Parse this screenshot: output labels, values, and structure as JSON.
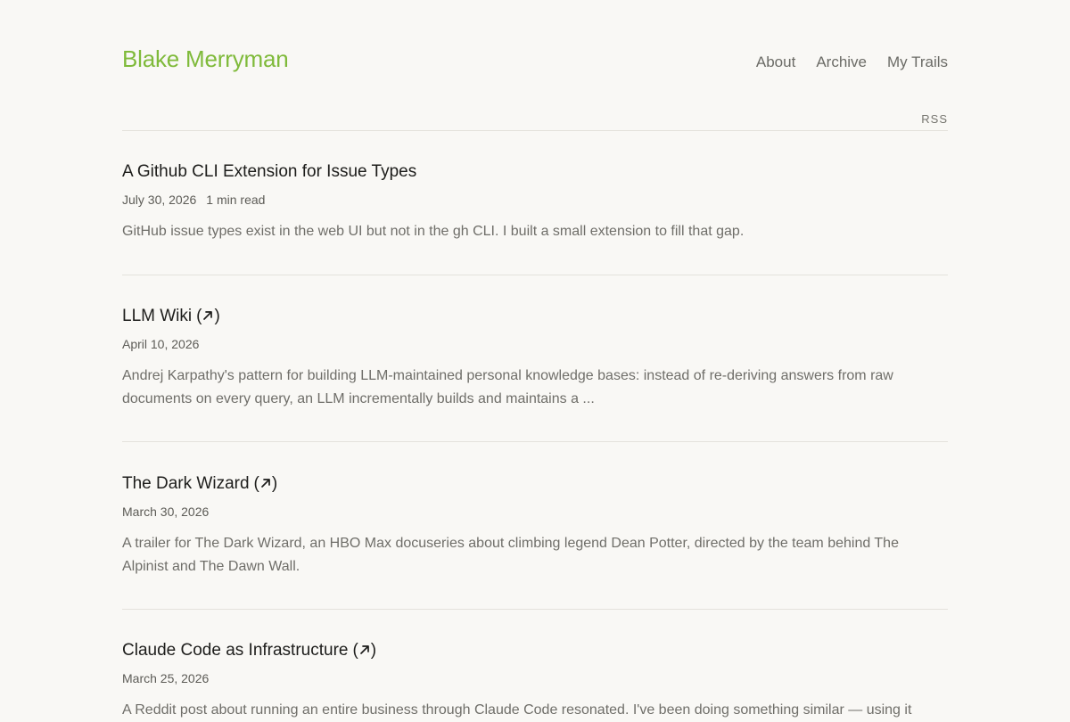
{
  "site": {
    "title": "Blake Merryman",
    "accent": "#7fba3a"
  },
  "nav": {
    "items": [
      "About",
      "Archive",
      "My Trails"
    ],
    "rss": "RSS"
  },
  "posts": [
    {
      "title": "A Github CLI Extension for Issue Types",
      "external": false,
      "date": "July 30, 2026",
      "read_time": "1 min read",
      "excerpt": "GitHub issue types exist in the web UI but not in the gh CLI. I built a small extension to fill that gap."
    },
    {
      "title": "LLM Wiki",
      "external": true,
      "date": "April 10, 2026",
      "read_time": "",
      "excerpt": "Andrej Karpathy's pattern for building LLM-maintained personal knowledge bases: instead of re-deriving answers from raw documents on every query, an LLM incrementally builds and maintains a ..."
    },
    {
      "title": "The Dark Wizard",
      "external": true,
      "date": "March 30, 2026",
      "read_time": "",
      "excerpt": "A trailer for The Dark Wizard, an HBO Max docuseries about climbing legend Dean Potter, directed by the team behind The Alpinist and The Dawn Wall."
    },
    {
      "title": "Claude Code as Infrastructure",
      "external": true,
      "date": "March 25, 2026",
      "read_time": "",
      "excerpt": "A Reddit post about running an entire business through Claude Code resonated. I've been doing something similar — using it"
    }
  ],
  "icons": {
    "external_link": "external-link-icon"
  }
}
